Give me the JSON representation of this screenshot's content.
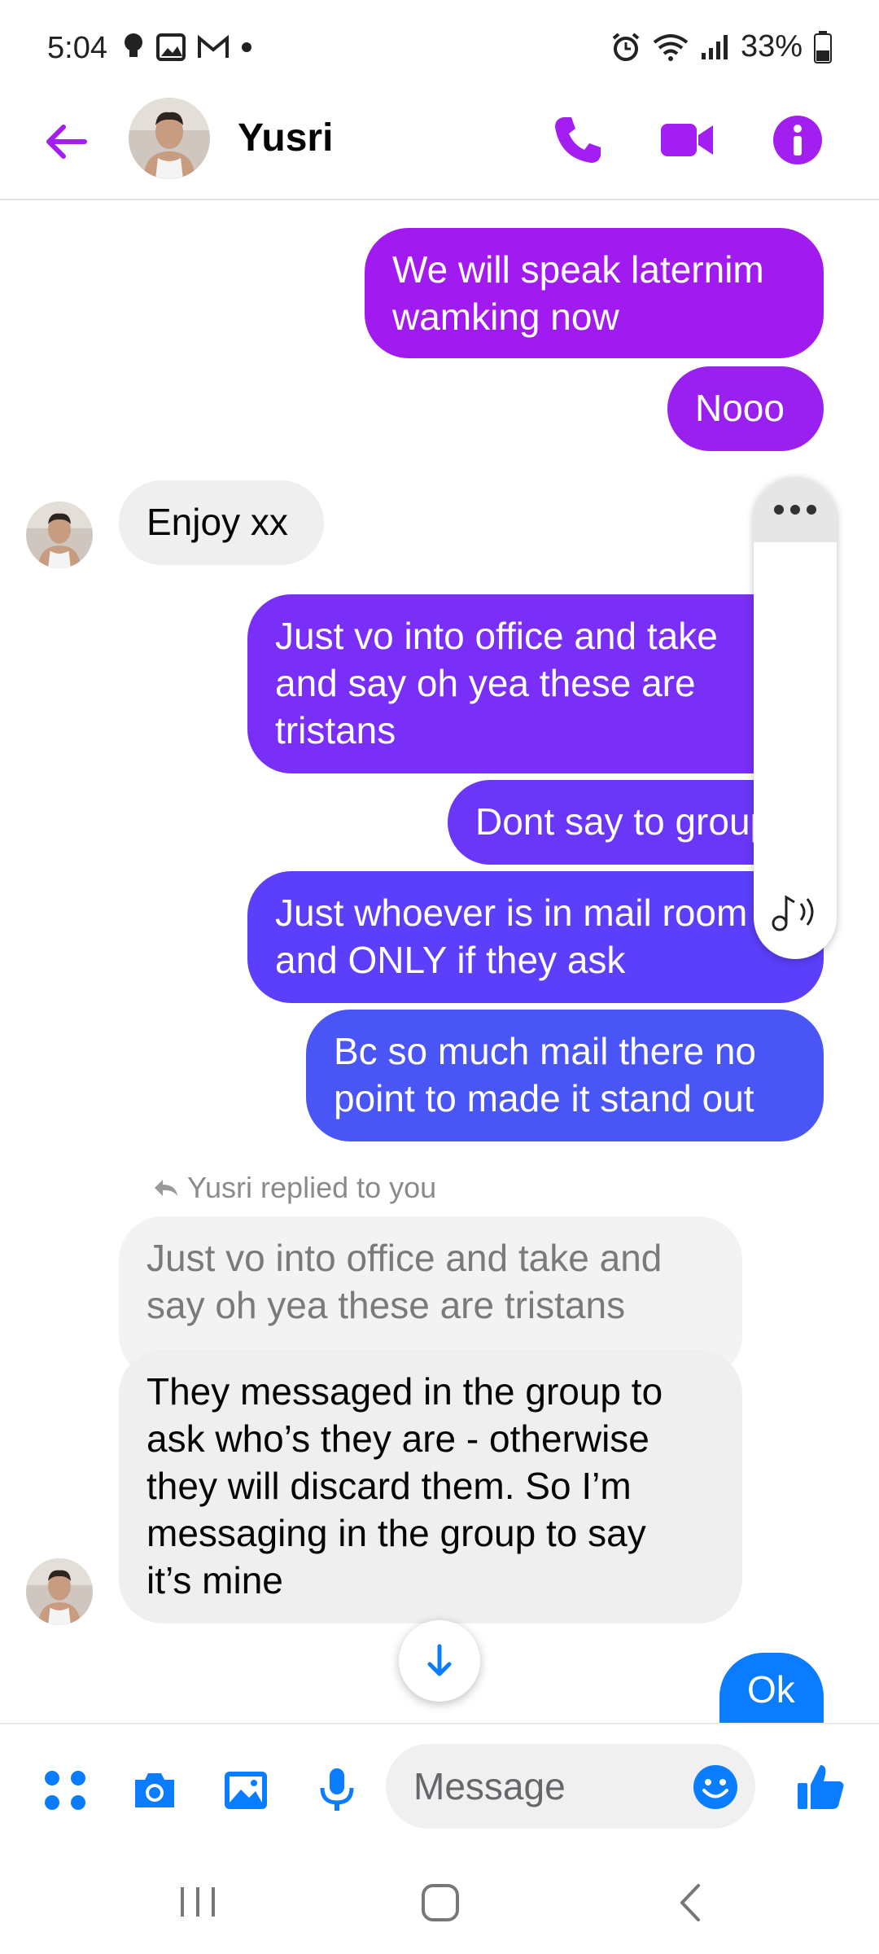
{
  "status_bar": {
    "time": "5:04",
    "battery": "33%"
  },
  "header": {
    "contact_name": "Yusri"
  },
  "messages": {
    "m1": [
      "We will speak laternim",
      "wamking now"
    ],
    "m2": [
      "Nooo"
    ],
    "m3": [
      "Enjoy xx"
    ],
    "m4": [
      "Just vo into office and take",
      "and say oh yea these are",
      "tristans"
    ],
    "m5": [
      "Dont say to group"
    ],
    "m6": [
      "Just whoever is in mail room",
      "and ONLY if they ask"
    ],
    "m7": [
      "Bc so much mail there no",
      "point to made it stand out"
    ],
    "reply_label": "Yusri replied to you",
    "quoted": [
      "Just vo into office and take and",
      "say oh yea these are tristans"
    ],
    "m8": [
      "They messaged in the group to",
      "ask who’s they are - otherwise",
      "they will discard them. So I’m",
      "messaging in the group to say",
      "it’s mine"
    ],
    "m9": [
      "Ok"
    ]
  },
  "composer": {
    "placeholder": "Message"
  },
  "colors": {
    "accent": "#a31ef0",
    "bubble_top": "#a11aef",
    "bubble_mid": "#7a2ff8",
    "bubble_low": "#5b3ffa",
    "bubble_bottom": "#4a55f5",
    "ok_bubble": "#0a7cff",
    "composer_icons": "#0a7cff"
  }
}
